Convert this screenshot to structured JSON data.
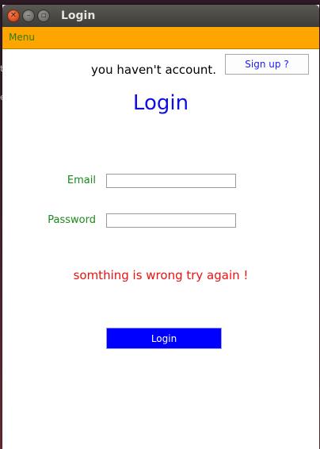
{
  "desktop": {
    "edge_glyphs": [
      "t",
      "e"
    ]
  },
  "window": {
    "title": "Login",
    "buttons": {
      "close_icon": "close-icon",
      "minimize_icon": "minimize-icon",
      "maximize_icon": "maximize-icon"
    }
  },
  "menubar": {
    "items": [
      {
        "label": "Menu"
      }
    ],
    "background_color": "#ffa500"
  },
  "signup_row": {
    "prompt": "you haven't account.",
    "button_label": "Sign up ?"
  },
  "form": {
    "heading": "Login",
    "email": {
      "label": "Email",
      "value": "",
      "placeholder": ""
    },
    "password": {
      "label": "Password",
      "value": "",
      "placeholder": ""
    },
    "error_message": "somthing is wrong try again !",
    "submit_label": "Login"
  },
  "colors": {
    "heading": "#1010dd",
    "field_label": "#1a8a1a",
    "error": "#ee1111",
    "submit_bg": "#0000ff"
  }
}
